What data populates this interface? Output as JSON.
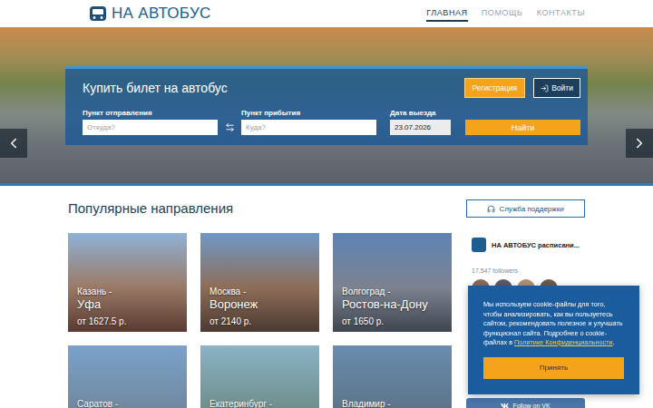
{
  "header": {
    "logo": "НА АВТОБУС",
    "nav": [
      {
        "label": "ГЛАВНАЯ",
        "selected": true
      },
      {
        "label": "ПОМОЩЬ",
        "selected": false
      },
      {
        "label": "КОНТАКТЫ",
        "selected": false
      }
    ]
  },
  "search": {
    "title": "Купить билет на автобус",
    "register_button": "Регистрация",
    "login_button": "Войти",
    "fields": [
      {
        "label": "Пункт отправления",
        "placeholder": "Откуда?",
        "value": ""
      },
      {
        "label": "Пункт прибытия",
        "placeholder": "Куда?",
        "value": ""
      },
      {
        "label": "Дата выезда",
        "placeholder": "",
        "value": "23.07.2026"
      }
    ],
    "submit": "Найти"
  },
  "popular": {
    "title": "Популярные направления",
    "routes": [
      {
        "from": "Казань -",
        "to": "Уфа",
        "price": "от 1627.5 р."
      },
      {
        "from": "Москва -",
        "to": "Воронеж",
        "price": "от 2140 р."
      },
      {
        "from": "Волгоград -",
        "to": "Ростов-на-Дону",
        "price": "от 1650 р."
      },
      {
        "from": "Саратов -",
        "to": "",
        "price": ""
      },
      {
        "from": "Екатеринбург -",
        "to": "",
        "price": ""
      },
      {
        "from": "Владимир -",
        "to": "",
        "price": ""
      }
    ]
  },
  "support_button": "Служба поддержки",
  "vk": {
    "name": "НА АВТОБУС расписани...",
    "followers": "17,547 followers",
    "follow_button": "Follow on VK"
  },
  "cookie": {
    "text": "Мы используем cookie-файлы для того, чтобы анализировать, как вы пользуетесь сайтом, рекомендовать полезное и улучшать функционал сайта. Подробнее о cookie-файлах в ",
    "link": "Политике Конфиденциальности",
    "end": ".",
    "accept": "Принять"
  }
}
